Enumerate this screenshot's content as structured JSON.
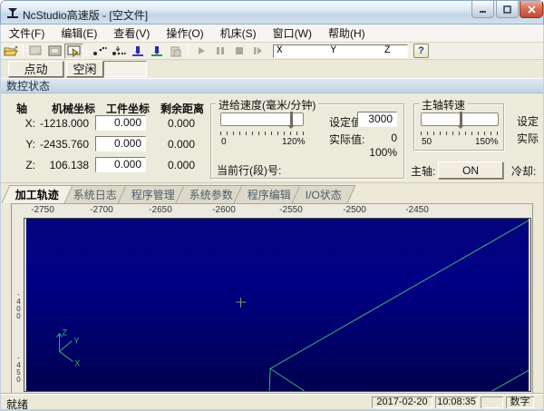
{
  "window": {
    "title": "NcStudio高速版 - [空文件]"
  },
  "menu": {
    "items": [
      "文件(F)",
      "编辑(E)",
      "查看(V)",
      "操作(O)",
      "机床(S)",
      "窗口(W)",
      "帮助(H)"
    ]
  },
  "toolbar": {
    "xyz_value": "X        Y        Z",
    "help_label": "?"
  },
  "mode_bar": {
    "jog": "点动",
    "idle": "空闲"
  },
  "nc_panel": {
    "title": "数控状态",
    "coord_table": {
      "headers": {
        "axis": "轴",
        "machine": "机械坐标",
        "work": "工件坐标",
        "remain": "剩余距离"
      },
      "rows": [
        {
          "axis": "X:",
          "machine": "-1218.000",
          "work": "0.000",
          "remain": "0.000"
        },
        {
          "axis": "Y:",
          "machine": "-2435.760",
          "work": "0.000",
          "remain": "0.000"
        },
        {
          "axis": "Z:",
          "machine": "106.138",
          "work": "0.000",
          "remain": "0.000"
        }
      ]
    },
    "feed_group": {
      "title": "进给速度(毫米/分钟)",
      "scale_min": "0",
      "scale_max": "120%",
      "set_label": "设定值:",
      "set_value": "3000",
      "actual_label": "实际值:",
      "actual_value": "0",
      "override": "100%",
      "current_line_label": "当前行(段)号:"
    },
    "spindle_group": {
      "title": "主轴转速",
      "scale_min": "50",
      "scale_max": "150%",
      "set_label": "设定",
      "actual_label": "实际",
      "spindle_label": "主轴:",
      "spindle_state": "ON",
      "coolant_label": "冷却:"
    }
  },
  "view_tabs": [
    "加工轨迹",
    "系统日志",
    "程序管理",
    "系统参数",
    "程序编辑",
    "I/O状态"
  ],
  "trace_view": {
    "x_ticks": [
      "-2750",
      "-2700",
      "-2650",
      "-2600",
      "-2550",
      "-2500",
      "-2450"
    ],
    "y_ticks": [
      "-400",
      "-450"
    ],
    "axis_triad": {
      "x": "X",
      "y": "Y",
      "z": "Z"
    },
    "colors": {
      "canvas_top": "#05057c",
      "canvas_mid": "#000086",
      "canvas_bottom": "#000050",
      "trace_line": "#3cb371"
    }
  },
  "status_bar": {
    "message": "就绪",
    "date": "2017-02-20",
    "time": "10:08:35",
    "num_indicator": "数字"
  }
}
